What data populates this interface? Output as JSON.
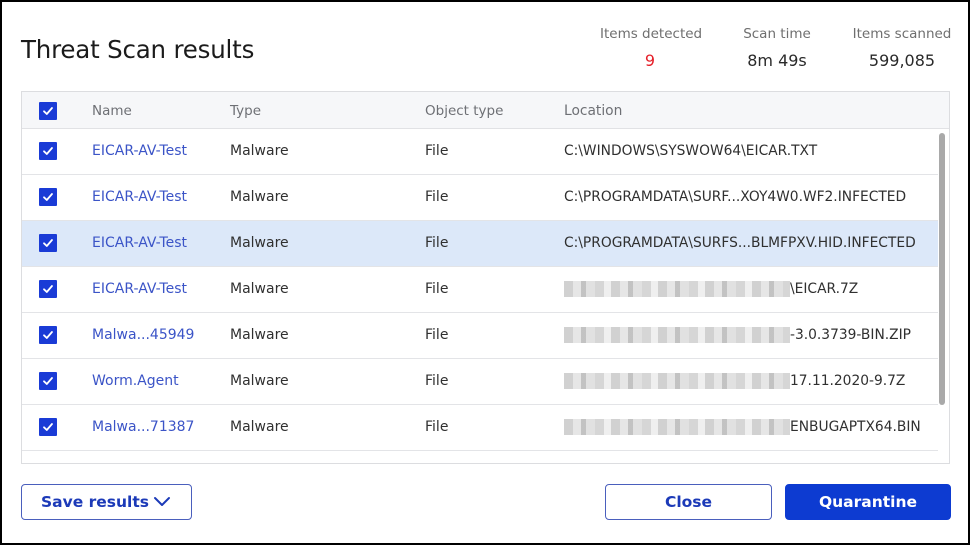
{
  "dialog": {
    "title": "Threat Scan results"
  },
  "stats": {
    "items_detected": {
      "label": "Items detected",
      "value": "9"
    },
    "scan_time": {
      "label": "Scan time",
      "value": "8m 49s"
    },
    "items_scanned": {
      "label": "Items scanned",
      "value": "599,085"
    }
  },
  "colors": {
    "accent": "#1a3bd6",
    "primary_button": "#0d3bd1",
    "alert": "#e5202a",
    "selected_row": "#dce8f9",
    "link": "#3b54c7"
  },
  "table": {
    "select_all_checked": true,
    "columns": [
      "Name",
      "Type",
      "Object type",
      "Location"
    ],
    "rows": [
      {
        "checked": true,
        "name": "EICAR-AV-Test",
        "type": "Malware",
        "object_type": "File",
        "location": "C:\\WINDOWS\\SYSWOW64\\EICAR.TXT",
        "location_redacted": false,
        "selected": false
      },
      {
        "checked": true,
        "name": "EICAR-AV-Test",
        "type": "Malware",
        "object_type": "File",
        "location": "C:\\PROGRAMDATA\\SURF...XOY4W0.WF2.INFECTED",
        "location_redacted": false,
        "selected": false
      },
      {
        "checked": true,
        "name": "EICAR-AV-Test",
        "type": "Malware",
        "object_type": "File",
        "location": "C:\\PROGRAMDATA\\SURFS...BLMFPXV.HID.INFECTED",
        "location_redacted": false,
        "selected": true
      },
      {
        "checked": true,
        "name": "EICAR-AV-Test",
        "type": "Malware",
        "object_type": "File",
        "location": "\\EICAR.7Z",
        "location_redacted": true,
        "selected": false
      },
      {
        "checked": true,
        "name": "Malwa...45949",
        "type": "Malware",
        "object_type": "File",
        "location": "-3.0.3739-BIN.ZIP",
        "location_redacted": true,
        "selected": false
      },
      {
        "checked": true,
        "name": "Worm.Agent",
        "type": "Malware",
        "object_type": "File",
        "location": "17.11.2020-9.7Z",
        "location_redacted": true,
        "selected": false
      },
      {
        "checked": true,
        "name": "Malwa...71387",
        "type": "Malware",
        "object_type": "File",
        "location": "ENBUGAPTX64.BIN",
        "location_redacted": true,
        "selected": false
      }
    ]
  },
  "buttons": {
    "save_results": "Save results",
    "close": "Close",
    "quarantine": "Quarantine"
  },
  "icons": {
    "checkbox": "checkmark-icon",
    "save_dropdown": "chevron-down-icon"
  }
}
